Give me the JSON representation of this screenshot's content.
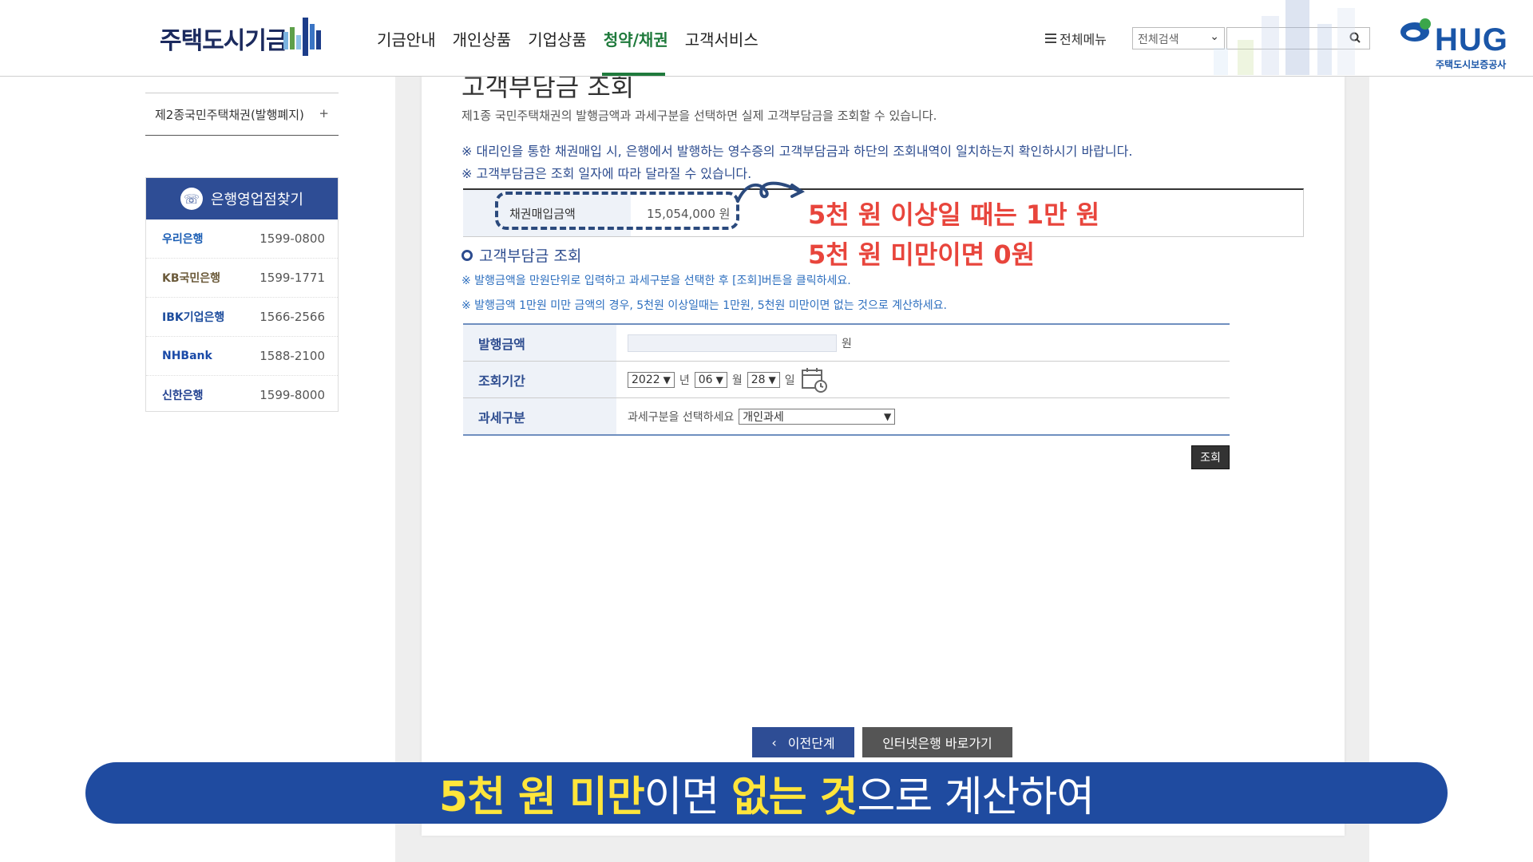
{
  "header": {
    "logo_text": "주택도시기금",
    "nav": [
      "기금안내",
      "개인상품",
      "기업상품",
      "청약/채권",
      "고객서비스"
    ],
    "active_nav": "청약/채권",
    "menu_label": "전체메뉴",
    "search_select": "전체검색",
    "search_placeholder": "",
    "hug_text": "HUG",
    "hug_sub": "주택도시보증공사",
    "accent_color": "#1f7a3c"
  },
  "sidebar": {
    "bond_item": "제2종국민주택채권(발행폐지)",
    "bond_expand": "+",
    "bank_title": "은행영업점찾기",
    "banks": [
      {
        "name": "우리은행",
        "phone": "1599-0800",
        "color": "#1a5db4"
      },
      {
        "name": "KB국민은행",
        "phone": "1599-1771",
        "color": "#6b5a3a"
      },
      {
        "name": "IBK기업은행",
        "phone": "1566-2566",
        "color": "#1b4b9c"
      },
      {
        "name": "NHBank",
        "phone": "1588-2100",
        "color": "#1a4aa8"
      },
      {
        "name": "신한은행",
        "phone": "1599-8000",
        "color": "#1f3f8f"
      }
    ]
  },
  "main": {
    "title": "고객부담금 조회",
    "description": "제1종 국민주택채권의 발행금액과 과세구분을 선택하면 실제 고객부담금을 조회할 수 있습니다.",
    "notice1": "※ 대리인을 통한 채권매입 시, 은행에서 발행하는 영수증의 고객부담금과 하단의 조회내역이 일치하는지 확인하시기 바랍니다.",
    "notice2": "※ 고객부담금은 조회 일자에 따라 달라질 수 있습니다.",
    "summary_label": "채권매입금액",
    "summary_value": "15,054,000 원",
    "annotation1": "5천 원 이상일 때는 1만 원",
    "annotation2": "5천 원 미만이면 0원",
    "section_title": "고객부담금 조회",
    "subnote1": "※ 발행금액을 만원단위로 입력하고 과세구분을 선택한 후 [조회]버튼을 클릭하세요.",
    "subnote2": "※ 발행금액 1만원 미만 금액의 경우, 5천원 이상일때는 1만원, 5천원 미만이면 없는 것으로 계산하세요.",
    "form": {
      "amount_label": "발행금액",
      "amount_unit": "원",
      "period_label": "조회기간",
      "year": "2022",
      "year_unit": "년",
      "month": "06",
      "month_unit": "월",
      "day": "28",
      "day_unit": "일",
      "tax_label": "과세구분",
      "tax_prompt": "과세구분을 선택하세요",
      "tax_value": "개인과세"
    },
    "query_button": "조회",
    "prev_button": "이전단계",
    "bank_button": "인터넷은행 바로가기"
  },
  "caption": {
    "part1": "5천 원 미만",
    "part2": "이면 ",
    "part3": "없는 것",
    "part4": "으로 계산하여"
  }
}
